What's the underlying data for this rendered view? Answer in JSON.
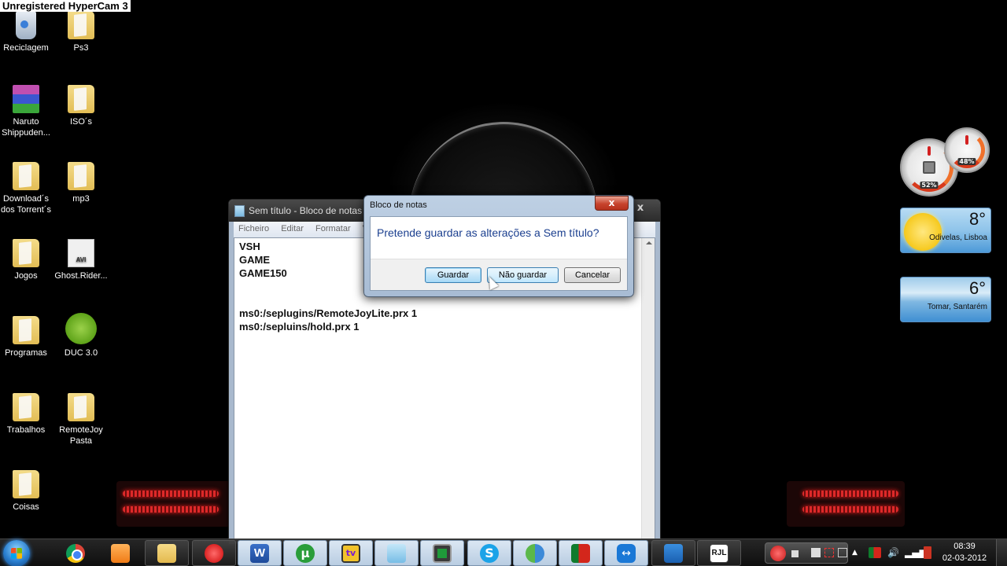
{
  "watermark": "Unregistered HyperCam 3",
  "desktop_icons": [
    {
      "label": "Reciclagem",
      "icon": "recycle-bin-icon"
    },
    {
      "label": "Ps3",
      "icon": "folder-icon"
    },
    {
      "label": "Naruto Shippuden...",
      "icon": "winrar-archive-icon"
    },
    {
      "label": "ISO´s",
      "icon": "folder-icon"
    },
    {
      "label": "Download´s dos Torrent´s",
      "icon": "folder-icon"
    },
    {
      "label": "mp3",
      "icon": "folder-icon"
    },
    {
      "label": "Jogos",
      "icon": "folder-icon"
    },
    {
      "label": "Ghost.Rider...",
      "icon": "avi-video-icon"
    },
    {
      "label": "Programas",
      "icon": "folder-icon"
    },
    {
      "label": "DUC 3.0",
      "icon": "duc-shortcut-icon"
    },
    {
      "label": "Trabalhos",
      "icon": "folder-icon"
    },
    {
      "label": "RemoteJoy Pasta",
      "icon": "folder-icon"
    },
    {
      "label": "Coisas",
      "icon": "folder-icon"
    }
  ],
  "notepad": {
    "title": "Sem título - Bloco de notas",
    "close_label": "x",
    "menu": [
      "Ficheiro",
      "Editar",
      "Formatar",
      "V"
    ],
    "content": "VSH\nGAME\nGAME150\n\n\nms0:/seplugins/RemoteJoyLite.prx 1\nms0:/sepluins/hold.prx 1"
  },
  "dialog": {
    "title": "Bloco de notas",
    "close_label": "x",
    "message": "Pretende guardar as alterações a Sem título?",
    "buttons": {
      "save": "Guardar",
      "dont_save": "Não guardar",
      "cancel": "Cancelar"
    }
  },
  "gadgets": {
    "cpu_percent": "52%",
    "memory_percent": "48%",
    "weather": [
      {
        "temp": "8°",
        "location": "Odivelas, Lisboa",
        "condition": "sunny"
      },
      {
        "temp": "6°",
        "location": "Tomar, Santarém",
        "condition": "cloudy"
      }
    ]
  },
  "taskbar": {
    "pinned": [
      "Start",
      "Google Chrome",
      "Windows Media Player",
      "Windows Explorer",
      "HyperCam Record",
      "Microsoft Word",
      "uTorrent",
      "TV App",
      "Bloco de notas",
      "Command Prompt",
      "Skype",
      "Windows Live Messenger",
      "Portugal App",
      "TeamViewer",
      "Desktop Gadgets",
      "RJL"
    ],
    "rjl_label": "RJL",
    "word_label": "W",
    "utorrent_label": "µ",
    "skype_label": "S",
    "tv_label": "tv",
    "tray_arrow": "▲",
    "volume_glyph": "🔊",
    "network_glyph": "▂▄▆",
    "time": "08:39",
    "date": "02-03-2012"
  }
}
